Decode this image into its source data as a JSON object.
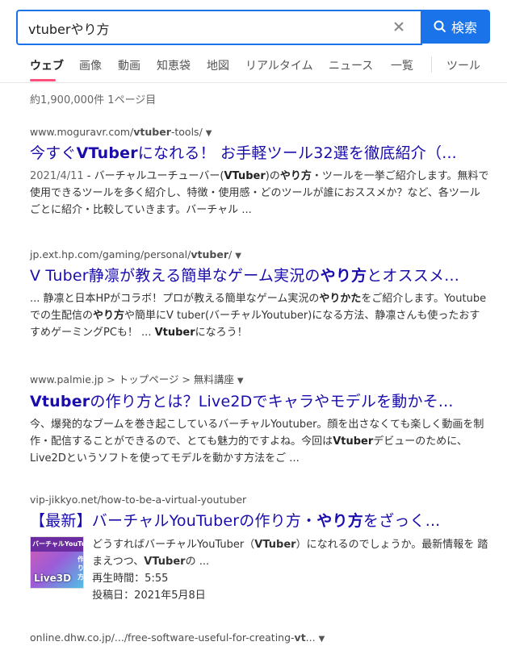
{
  "search": {
    "query": "vtuberやり方",
    "button_label": "検索"
  },
  "tabs": [
    {
      "label": "ウェブ"
    },
    {
      "label": "画像"
    },
    {
      "label": "動画"
    },
    {
      "label": "知恵袋"
    },
    {
      "label": "地図"
    },
    {
      "label": "リアルタイム"
    },
    {
      "label": "ニュース"
    },
    {
      "label": "一覧"
    },
    {
      "label": "ツール"
    }
  ],
  "stats": "約1,900,000件  1ページ目",
  "results": [
    {
      "url_pre": "www.moguravr.com/",
      "url_bold": "vtuber",
      "url_post": "-tools/",
      "title_pre": "今すぐ",
      "title_bold": "VTuber",
      "title_post": "になれる！ お手軽ツール32選を徹底紹介（...",
      "date": "2021/4/11",
      "snippet_parts": [
        " - バーチャルユーチューバー(",
        "VTuber",
        ")の",
        "やり方",
        "・ツールを一挙ご紹介します。無料で使用できるツールを多く紹介し、特徴・使用感・どのツールが誰におススメか？など、各ツールごとに紹介・比較していきます。バーチャル ..."
      ]
    },
    {
      "url_pre": "jp.ext.hp.com/gaming/personal/",
      "url_bold": "vtuber",
      "url_post": "/",
      "title_pre": "V Tuber静凛が教える簡単なゲーム実況の",
      "title_bold": "やり方",
      "title_post": "とオススメ...",
      "snippet_parts": [
        "... 静凛と日本HPがコラボ！プロが教える簡単なゲーム実況の",
        "やりかた",
        "をご紹介します。Youtubeでの生配信の",
        "やり方",
        "や簡単にV tuber(バーチャルYoutuber)になる方法、静凛さんも使ったおすすめゲーミングPCも！ ... ",
        "Vtuber",
        "になろう！"
      ]
    },
    {
      "url_text": "www.palmie.jp > トップページ > 無料講座",
      "title_bold": "Vtuber",
      "title_post": "の作り方とは？Live2Dでキャラやモデルを動かそ...",
      "snippet_parts": [
        "今、爆発的なブームを巻き起こしているバーチャルYoutuber。顔を出さなくても楽しく動画を制作・配信することができるので、とても魅力的ですよね。今回は",
        "Vtuber",
        "デビューのために、Live2Dというソフトを使ってモデルを動かす方法をご ..."
      ]
    },
    {
      "url_text": "vip-jikkyo.net/how-to-be-a-virtual-youtuber",
      "title_pre": "【最新】バーチャルYouTuberの作り方・",
      "title_bold": "やり方",
      "title_post": "をざっく...",
      "video": {
        "thumb_line1": "バーチャルYouTuber",
        "thumb_line2": "作り方",
        "thumb_line3": "Live3D",
        "desc_parts": [
          "どうすればバーチャルYouTuber（",
          "VTuber",
          "）になれるのでしょうか。最新情報を 踏まえつつ、",
          "VTuber",
          "の ..."
        ],
        "duration": "再生時間：5:55",
        "posted": "投稿日：2021年5月8日"
      }
    },
    {
      "url_pre": "online.dhw.co.jp/.../free-software-useful-for-creating-",
      "url_bold": "vt",
      "url_post": "..."
    }
  ]
}
